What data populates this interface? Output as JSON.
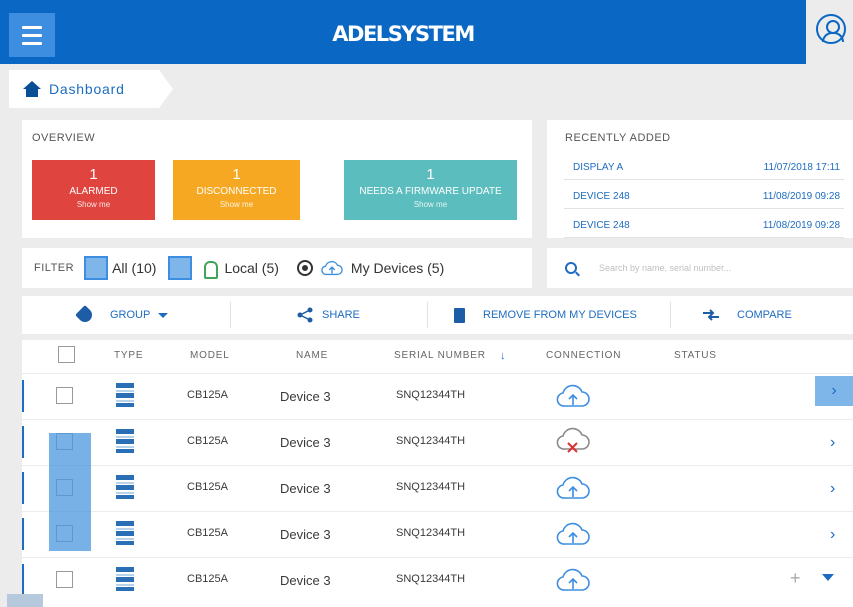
{
  "header": {
    "brand": "ADELSYSTEM",
    "menu_icon": "hamburger-icon",
    "user_icon": "user-icon"
  },
  "breadcrumb": {
    "label": "Dashboard",
    "icon": "home-icon"
  },
  "overview": {
    "title": "OVERVIEW",
    "cards": [
      {
        "count": "1",
        "label": "ALARMED",
        "link": "Show me",
        "color": "#e0443f"
      },
      {
        "count": "1",
        "label": "DISCONNECTED",
        "link": "Show me",
        "color": "#f7a823"
      },
      {
        "count": "1",
        "label": "NEEDS A FIRMWARE UPDATE",
        "link": "Show me",
        "color": "#5bbdbe"
      }
    ]
  },
  "recent": {
    "title": "RECENTLY ADDED",
    "items": [
      {
        "name": "DISPLAY A",
        "date": "11/07/2018 17:11"
      },
      {
        "name": "DEVICE 248",
        "date": "11/08/2019 09:28"
      },
      {
        "name": "DEVICE 248",
        "date": "11/08/2019 09:28"
      }
    ]
  },
  "filter": {
    "label": "FILTER",
    "all": "All (10)",
    "local": "Local (5)",
    "my_devices": "My Devices (5)"
  },
  "search": {
    "placeholder": "Search by name, serial number..."
  },
  "actions": {
    "group": "GROUP",
    "share": "SHARE",
    "remove": "REMOVE FROM MY DEVICES",
    "compare": "COMPARE"
  },
  "table": {
    "headers": [
      "TYPE",
      "MODEL",
      "NAME",
      "SERIAL NUMBER",
      "CONNECTION",
      "STATUS"
    ],
    "sort_indicator": "↓",
    "rows": [
      {
        "model": "CB125A",
        "name": "Device 3",
        "serial": "SNQ12344TH",
        "connection": "connected"
      },
      {
        "model": "CB125A",
        "name": "Device 3",
        "serial": "SNQ12344TH",
        "connection": "disconnected"
      },
      {
        "model": "CB125A",
        "name": "Device 3",
        "serial": "SNQ12344TH",
        "connection": "connected"
      },
      {
        "model": "CB125A",
        "name": "Device 3",
        "serial": "SNQ12344TH",
        "connection": "connected"
      },
      {
        "model": "CB125A",
        "name": "Device 3",
        "serial": "SNQ12344TH",
        "connection": "connected"
      }
    ]
  },
  "colors": {
    "primary": "#0a67c3",
    "link": "#1d6cc0",
    "selection": "#7fb6ea"
  }
}
